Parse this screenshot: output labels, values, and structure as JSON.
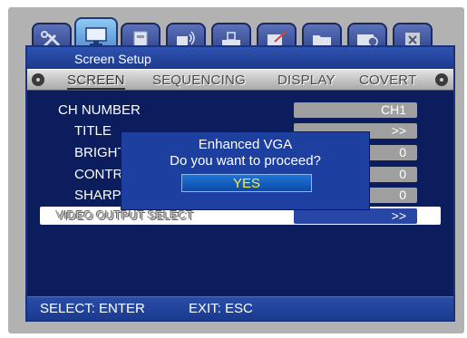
{
  "window": {
    "title": "Screen Setup"
  },
  "tabs": [
    {
      "icon": "tools-icon"
    },
    {
      "icon": "monitor-icon"
    },
    {
      "icon": "disk-icon"
    },
    {
      "icon": "camera-icon"
    },
    {
      "icon": "network-icon"
    },
    {
      "icon": "record-icon"
    },
    {
      "icon": "folder-icon"
    },
    {
      "icon": "export-icon"
    },
    {
      "icon": "close-box-icon"
    }
  ],
  "menu": {
    "items": [
      {
        "label": "SCREEN"
      },
      {
        "label": "SEQUENCING"
      },
      {
        "label": "DISPLAY"
      },
      {
        "label": "COVERT"
      }
    ]
  },
  "settings": {
    "ch_number": {
      "label": "CH NUMBER",
      "value": "CH1"
    },
    "title": {
      "label": "TITLE",
      "value": ">>"
    },
    "brightness": {
      "label": "BRIGHT",
      "value": "0"
    },
    "contrast": {
      "label": "CONTR",
      "value": "0"
    },
    "sharpness": {
      "label": "SHARP",
      "value": "0"
    },
    "video_output": {
      "label": "VIDEO OUTPUT SELECT",
      "value": ">>"
    }
  },
  "dialog": {
    "title": "Enhanced VGA",
    "message": "Do you want to proceed?",
    "yes_label": "YES"
  },
  "footer": {
    "select_hint": "SELECT: ENTER",
    "exit_hint": "EXIT: ESC"
  },
  "colors": {
    "panel": "#0b1d5c",
    "dialog": "#1d3fa0",
    "selected_row": "#ffffff",
    "yes_text": "#ffec3a"
  }
}
